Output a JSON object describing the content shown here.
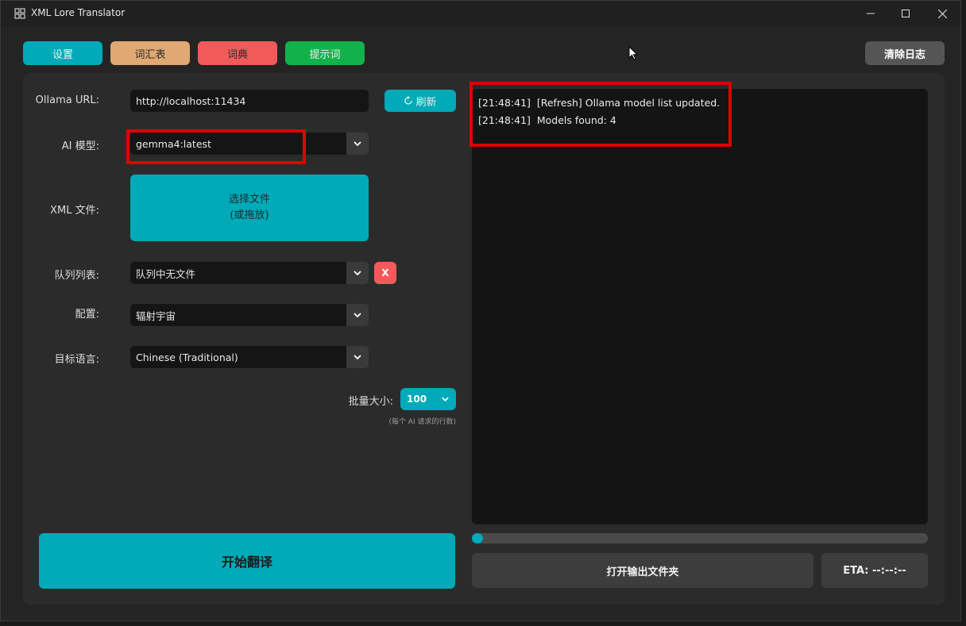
{
  "window": {
    "title": "XML Lore Translator"
  },
  "toolbar": {
    "settings": "设置",
    "glossary": "词汇表",
    "dictionary": "词典",
    "prompts": "提示词",
    "clear_log": "清除日志"
  },
  "colors": {
    "accent": "#00aab8",
    "glossary": "#e0a872",
    "dictionary": "#f25a5a",
    "prompts": "#12b24a",
    "clear": "#555555",
    "highlight": "#e10000"
  },
  "form": {
    "ollama_url_label": "Ollama URL:",
    "ollama_url_value": "http://localhost:11434",
    "refresh_label": "刷新",
    "model_label": "AI 模型:",
    "model_value": "gemma4:latest",
    "xml_label": "XML 文件:",
    "choose_file_line1": "选择文件",
    "choose_file_line2": "(或拖放)",
    "queue_label": "队列列表:",
    "queue_value": "队列中无文件",
    "queue_clear": "X",
    "profile_label": "配置:",
    "profile_value": "辐射宇宙",
    "language_label": "目标语言:",
    "language_value": "Chinese (Traditional)",
    "batch_label": "批量大小:",
    "batch_value": "100",
    "batch_hint": "(每个 AI 请求的行数)"
  },
  "actions": {
    "start": "开始翻译",
    "open_output": "打开输出文件夹",
    "eta": "ETA: --:--:--"
  },
  "log": {
    "lines": [
      "[21:48:41]  [Refresh] Ollama model list updated.",
      "[21:48:41]  Models found: 4"
    ]
  },
  "progress": {
    "fraction": 0
  }
}
